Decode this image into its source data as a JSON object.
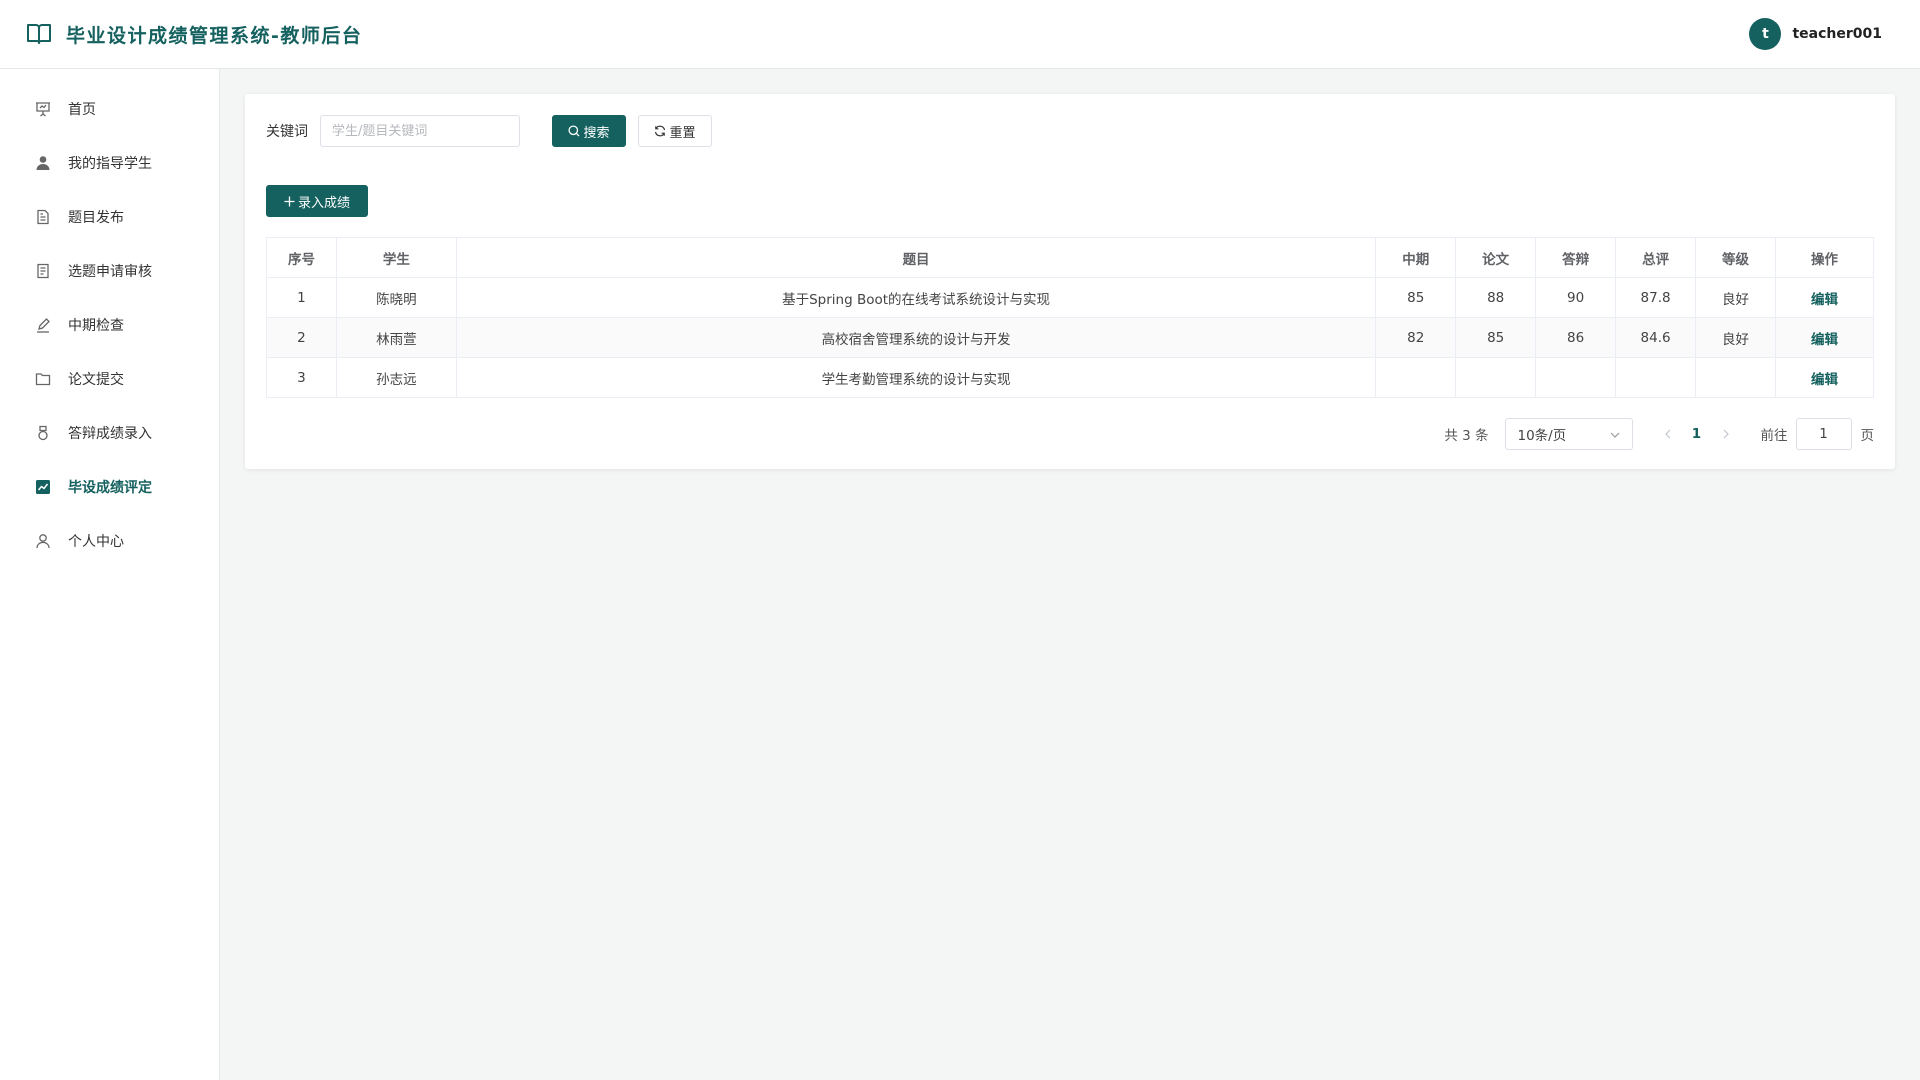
{
  "header": {
    "title": "毕业设计成绩管理系统-教师后台",
    "avatar_letter": "t",
    "username": "teacher001"
  },
  "sidebar": {
    "items": [
      {
        "label": "首页",
        "icon": "presentation-icon"
      },
      {
        "label": "我的指导学生",
        "icon": "user-filled-icon"
      },
      {
        "label": "题目发布",
        "icon": "document-icon"
      },
      {
        "label": "选题申请审核",
        "icon": "document-list-icon"
      },
      {
        "label": "中期检查",
        "icon": "edit-pen-icon"
      },
      {
        "label": "论文提交",
        "icon": "folder-icon"
      },
      {
        "label": "答辩成绩录入",
        "icon": "medal-icon"
      },
      {
        "label": "毕设成绩评定",
        "icon": "trend-chart-icon",
        "active": true
      },
      {
        "label": "个人中心",
        "icon": "user-icon"
      }
    ]
  },
  "search": {
    "label": "关键词",
    "placeholder": "学生/题目关键词",
    "value": "",
    "search_button": "搜索",
    "reset_button": "重置"
  },
  "actions": {
    "add_button": "录入成绩"
  },
  "table": {
    "columns": [
      "序号",
      "学生",
      "题目",
      "中期",
      "论文",
      "答辩",
      "总评",
      "等级",
      "操作"
    ],
    "rows": [
      {
        "index": "1",
        "student": "陈晓明",
        "topic": "基于Spring Boot的在线考试系统设计与实现",
        "midterm": "85",
        "thesis": "88",
        "defense": "90",
        "total": "87.8",
        "grade": "良好",
        "action": "编辑"
      },
      {
        "index": "2",
        "student": "林雨萱",
        "topic": "高校宿舍管理系统的设计与开发",
        "midterm": "82",
        "thesis": "85",
        "defense": "86",
        "total": "84.6",
        "grade": "良好",
        "action": "编辑"
      },
      {
        "index": "3",
        "student": "孙志远",
        "topic": "学生考勤管理系统的设计与实现",
        "midterm": "",
        "thesis": "",
        "defense": "",
        "total": "",
        "grade": "",
        "action": "编辑"
      }
    ]
  },
  "pagination": {
    "total_text": "共 3 条",
    "page_size": "10条/页",
    "current_page": "1",
    "goto_label": "前往",
    "goto_value": "1",
    "page_unit": "页"
  },
  "colors": {
    "primary": "#15615f",
    "background": "#f4f5f5"
  }
}
